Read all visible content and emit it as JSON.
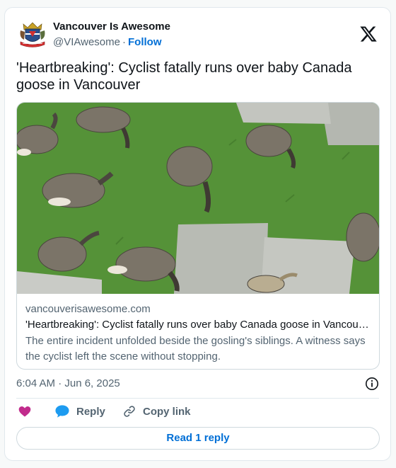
{
  "author": {
    "name": "Vancouver Is Awesome",
    "handle": "@VIAwesome",
    "separator": "·",
    "follow_label": "Follow"
  },
  "tweet": {
    "text": "'Heartbreaking': Cyclist fatally runs over baby Canada goose in Vancouver",
    "timestamp": "6:04 AM · Jun 6, 2025"
  },
  "link_card": {
    "domain": "vancouverisawesome.com",
    "title": "'Heartbreaking': Cyclist fatally runs over baby Canada goose in Vancouver",
    "description": "The entire incident unfolded beside the gosling's siblings. A witness says the cyclist left the scene without stopping."
  },
  "actions": {
    "reply_label": "Reply",
    "copy_link_label": "Copy link"
  },
  "read_replies_label": "Read 1 reply",
  "icons": {
    "like": "heart-icon",
    "reply": "speech-bubble-icon",
    "copy": "link-icon",
    "info": "info-icon",
    "brand": "x-logo-icon"
  },
  "colors": {
    "link_blue": "#006fd6",
    "like_pink": "#f91880",
    "reply_blue": "#1d9bf0",
    "muted_text": "#536471",
    "border": "#cfd9de"
  }
}
